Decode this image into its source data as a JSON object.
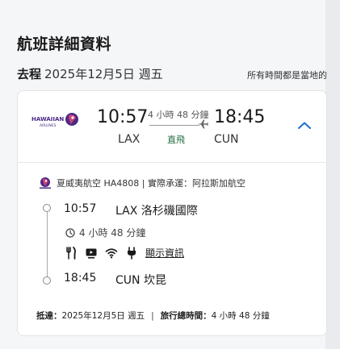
{
  "page": {
    "title": "航班詳細資料"
  },
  "leg": {
    "direction": "去程",
    "date": "2025年12月5日 週五",
    "timezone_note": "所有時間都是當地的"
  },
  "summary": {
    "airline_logo": "hawaiian-airlines-logo",
    "departure_time": "10:57",
    "departure_code": "LAX",
    "duration": "4 小時 48 分鐘",
    "stops": "直飛",
    "arrival_time": "18:45",
    "arrival_code": "CUN",
    "collapse_icon": "chevron-up-icon"
  },
  "segment": {
    "operator_text": "夏威夷航空 HA4808 | 實際承運：阿拉斯加航空",
    "departure_time": "10:57",
    "departure_airport": "LAX 洛杉磯國際",
    "duration": "4 小時 48 分鐘",
    "amenities": [
      "meal-icon",
      "entertainment-icon",
      "wifi-icon",
      "power-icon"
    ],
    "show_info_label": "顯示資訊",
    "arrival_time": "18:45",
    "arrival_airport": "CUN 坎昆"
  },
  "footer": {
    "arrival_label": "抵達：",
    "arrival_value": "2025年12月5日 週五",
    "separator": "|",
    "total_label": "旅行總時間：",
    "total_value": "4 小時 48 分鐘"
  },
  "colors": {
    "accent": "#1a6dc9",
    "stops_green": "#1f6b3f",
    "hawaiian_purple": "#4b2a86",
    "hawaiian_pink": "#d0427a"
  }
}
